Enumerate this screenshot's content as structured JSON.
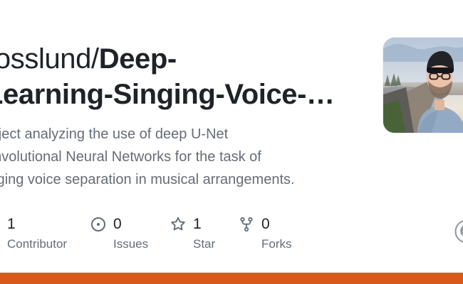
{
  "repo": {
    "owner": "rosslund",
    "separator": "/",
    "name_line1": "Deep-",
    "name_line2": "Learning-Singing-Voice-…"
  },
  "description": {
    "line1": "roject analyzing the use of deep U-Net",
    "line2": "onvolutional Neural Networks for the task of",
    "line3": "inging voice separation in musical arrangements."
  },
  "stats": {
    "contributors": {
      "count": "1",
      "label": "Contributor",
      "icon": "people-icon"
    },
    "issues": {
      "count": "0",
      "label": "Issues",
      "icon": "issue-opened-icon"
    },
    "stars": {
      "count": "1",
      "label": "Star",
      "icon": "star-icon"
    },
    "forks": {
      "count": "0",
      "label": "Forks",
      "icon": "repo-forked-icon"
    }
  },
  "colors": {
    "title": "#1f2328",
    "muted": "#656d76",
    "brand_bar": "#d85a19",
    "background": "#ffffff"
  },
  "avatar": {
    "icon": "user-photo"
  },
  "branding": {
    "icon": "github-mark-icon"
  }
}
